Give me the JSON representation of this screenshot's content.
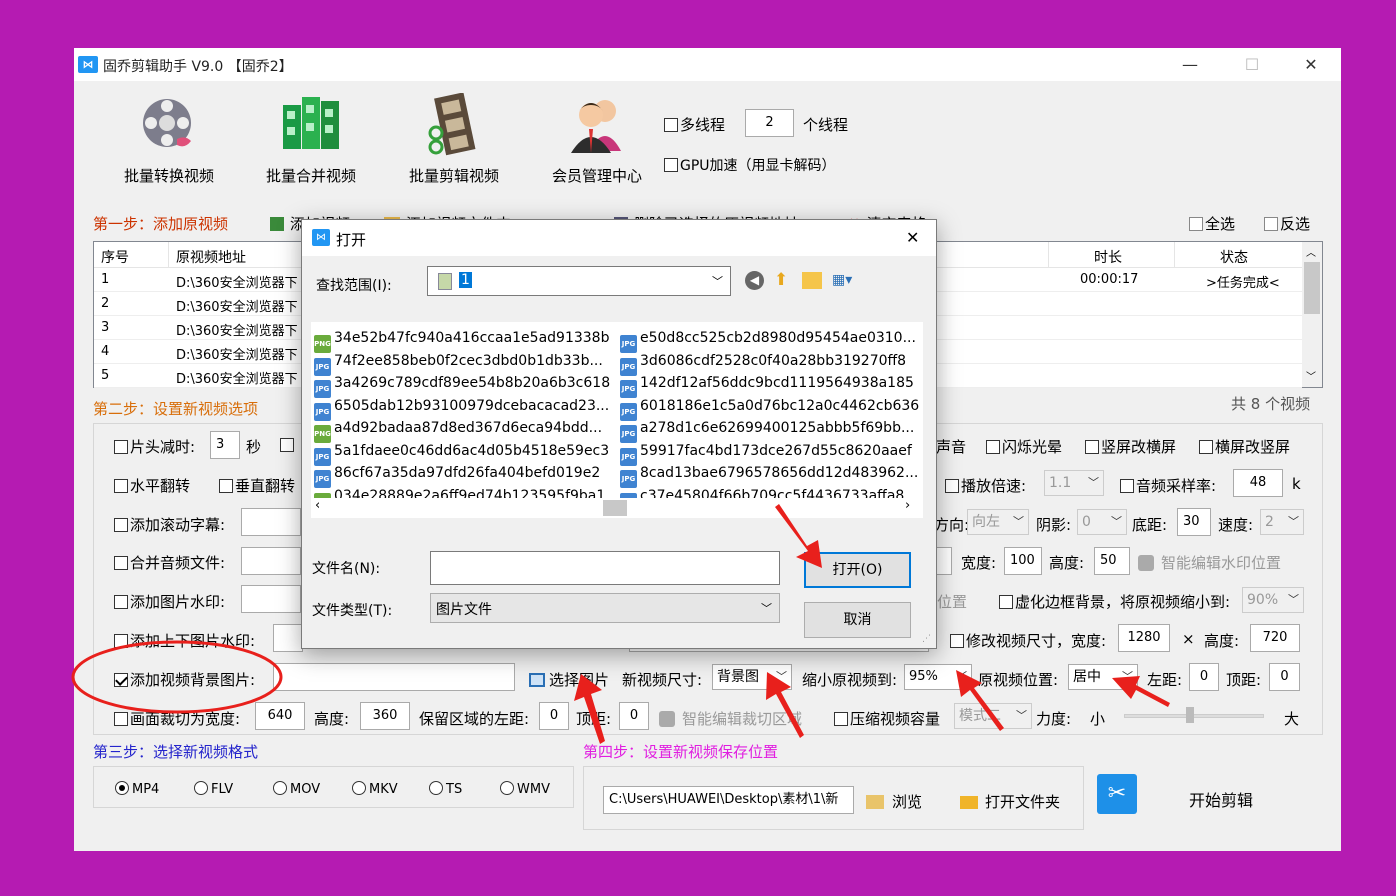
{
  "window": {
    "title": "固乔剪辑助手 V9.0 【固乔2】",
    "min": "—",
    "max": "☐",
    "close": "✕",
    "icon_label": "⋈"
  },
  "toolbar": {
    "convert": "批量转换视频",
    "merge": "批量合并视频",
    "edit": "批量剪辑视频",
    "member": "会员管理中心"
  },
  "options_top": {
    "multithread": "多线程",
    "thread_count": "2",
    "thread_unit": "个线程",
    "gpu": "GPU加速（用显卡解码）"
  },
  "step1": {
    "title": "第一步：添加原视频",
    "add_video": "添加视频",
    "add_folder": "添加视频文件夹",
    "remove": "删除已选择的原视频地址",
    "clear": "清空表格",
    "select_all": "全选",
    "invert": "反选"
  },
  "table": {
    "headers": [
      "序号",
      "原视频地址",
      "时长",
      "状态"
    ],
    "rows": [
      {
        "idx": "1",
        "path": "D:\\360安全浏览器下",
        "dur": "00:00:17",
        "status": ">任务完成<"
      },
      {
        "idx": "2",
        "path": "D:\\360安全浏览器下",
        "dur": "",
        "status": ""
      },
      {
        "idx": "3",
        "path": "D:\\360安全浏览器下",
        "dur": "",
        "status": ""
      },
      {
        "idx": "4",
        "path": "D:\\360安全浏览器下",
        "dur": "",
        "status": ""
      },
      {
        "idx": "5",
        "path": "D:\\360安全浏览器下",
        "dur": "",
        "status": ""
      }
    ],
    "count": "共 8 个视频"
  },
  "step2": {
    "title": "第二步：设置新视频选项",
    "head_cut": "片头减时:",
    "head_cut_val": "3",
    "sec": "秒",
    "sound": "声音",
    "flash": "闪烁光晕",
    "v2h": "竖屏改横屏",
    "h2v": "横屏改竖屏",
    "hflip": "水平翻转",
    "vflip": "垂直翻转",
    "speed": "播放倍速:",
    "speed_val": "1.1",
    "sample": "音频采样率:",
    "sample_val": "48",
    "sample_unit": "k",
    "scroll_sub": "添加滚动字幕:",
    "direction": "方向:",
    "direction_val": "向左",
    "shadow": "阴影:",
    "shadow_val": "0",
    "bottom": "底距:",
    "bottom_val": "30",
    "rate": "速度:",
    "rate_val": "2",
    "merge_audio": "合并音频文件:",
    "width": "宽度:",
    "width_val": "100",
    "height": "高度:",
    "height_val": "50",
    "wm_pos": "智能编辑水印位置",
    "img_wm": "添加图片水印:",
    "pos_tail": "位置",
    "blur_bg": "虚化边框背景，将原视频缩小到:",
    "blur_val": "90%",
    "updown_wm": "添加上下图片水印:",
    "resize": "修改视频尺寸，宽度:",
    "resize_w": "1280",
    "times": "×",
    "resize_h_lbl": "高度:",
    "resize_h": "720",
    "bg_img": "添加视频背景图片:",
    "choose_img": "选择图片",
    "new_size": "新视频尺寸:",
    "new_size_val": "背景图",
    "shrink": "缩小原视频到:",
    "shrink_val": "95%",
    "orig_pos": "原视频位置:",
    "orig_pos_val": "居中",
    "left": "左距:",
    "left_val": "0",
    "top": "顶距:",
    "top_val": "0",
    "crop": "画面裁切为宽度:",
    "crop_w": "640",
    "crop_h_lbl": "高度:",
    "crop_h": "360",
    "keep_left": "保留区域的左距:",
    "keep_left_val": "0",
    "keep_top": "顶距:",
    "keep_top_val": "0",
    "crop_area": "智能编辑裁切区域",
    "compress": "压缩视频容量",
    "compress_mode": "模式二",
    "force": "力度:",
    "small": "小",
    "big": "大"
  },
  "step3": {
    "title": "第三步：选择新视频格式",
    "formats": [
      "MP4",
      "FLV",
      "MOV",
      "MKV",
      "TS",
      "WMV"
    ]
  },
  "step4": {
    "title": "第四步：设置新视频保存位置",
    "path": "C:\\Users\\HUAWEI\\Desktop\\素材\\1\\新",
    "browse": "浏览",
    "open_folder": "打开文件夹",
    "start": "开始剪辑"
  },
  "dialog": {
    "title": "打开",
    "look_in": "查找范围(I):",
    "look_in_val": "1",
    "files_left": [
      {
        "name": "34e52b47fc940a416ccaa1e5ad91338b",
        "type": "PNG"
      },
      {
        "name": "74f2ee858beb0f2cec3dbd0b1db33b...",
        "type": "JPG"
      },
      {
        "name": "3a4269c789cdf89ee54b8b20a6b3c618",
        "type": "JPG"
      },
      {
        "name": "6505dab12b93100979dcebacacad23...",
        "type": "JPG"
      },
      {
        "name": "a4d92badaa87d8ed367d6eca94bdd...",
        "type": "PNG"
      },
      {
        "name": "5a1fdaee0c46dd6ac4d05b4518e59ec3",
        "type": "JPG"
      },
      {
        "name": "86cf67a35da97dfd26fa404befd019e2",
        "type": "JPG"
      },
      {
        "name": "034e28889e2a6ff9ed74b123595f9ba1",
        "type": "PNG"
      }
    ],
    "files_right": [
      {
        "name": "e50d8cc525cb2d8980d95454ae0310...",
        "type": "JPG"
      },
      {
        "name": "3d6086cdf2528c0f40a28bb319270ff8",
        "type": "JPG"
      },
      {
        "name": "142df12af56ddc9bcd1119564938a185",
        "type": "JPG"
      },
      {
        "name": "6018186e1c5a0d76bc12a0c4462cb636",
        "type": "JPG"
      },
      {
        "name": "a278d1c6e62699400125abbb5f69bb...",
        "type": "JPG"
      },
      {
        "name": "59917fac4bd173dce267d55c8620aaef",
        "type": "JPG"
      },
      {
        "name": "8cad13bae6796578656dd12d483962...",
        "type": "JPG"
      },
      {
        "name": "c37e45804f66b709cc5f4436733affa8",
        "type": "JPG"
      }
    ],
    "filename_lbl": "文件名(N):",
    "filetype_lbl": "文件类型(T):",
    "filetype_val": "图片文件",
    "open": "打开(O)",
    "cancel": "取消"
  },
  "colors": {
    "background": "#b51bb2",
    "annotation": "#e8201c"
  }
}
